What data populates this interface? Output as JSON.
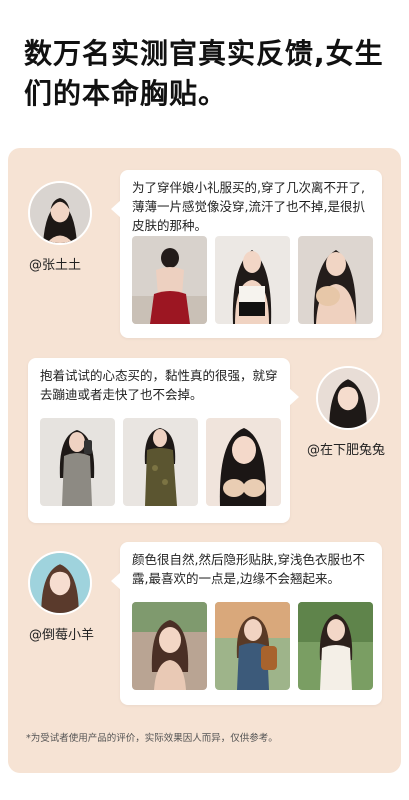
{
  "headline": "数万名实测官真实反馈,女生们的本命胸贴。",
  "reviews": [
    {
      "username": "@张土土",
      "text": "为了穿伴娘小礼服买的,穿了几次离不开了,薄薄一片感觉像没穿,流汗了也不掉,是很扒皮肤的那种。",
      "photos": [
        "red-dress-back-photo",
        "black-top-front-photo",
        "holding-bra-photo"
      ]
    },
    {
      "username": "@在下肥兔兔",
      "text": "抱着试试的心态买的，黏性真的很强，就穿去蹦迪或者走快了也不会掉。",
      "photos": [
        "gray-dress-mirror-photo",
        "floral-dress-mirror-photo",
        "holding-cups-photo"
      ]
    },
    {
      "username": "@倒莓小羊",
      "text": "颜色很自然,然后隐形贴肤,穿浅色衣服也不露,最喜欢的一点是,边缘不会翘起来。",
      "photos": [
        "cafe-portrait-photo",
        "garden-backpack-photo",
        "white-top-outdoor-photo"
      ]
    }
  ],
  "footnote": "*为受试者使用产品的评价，实际效果因人而异，仅供参考。",
  "colors": {
    "panel_bg": "#f6e3d4",
    "card_bg": "#ffffff",
    "text": "#222222"
  }
}
